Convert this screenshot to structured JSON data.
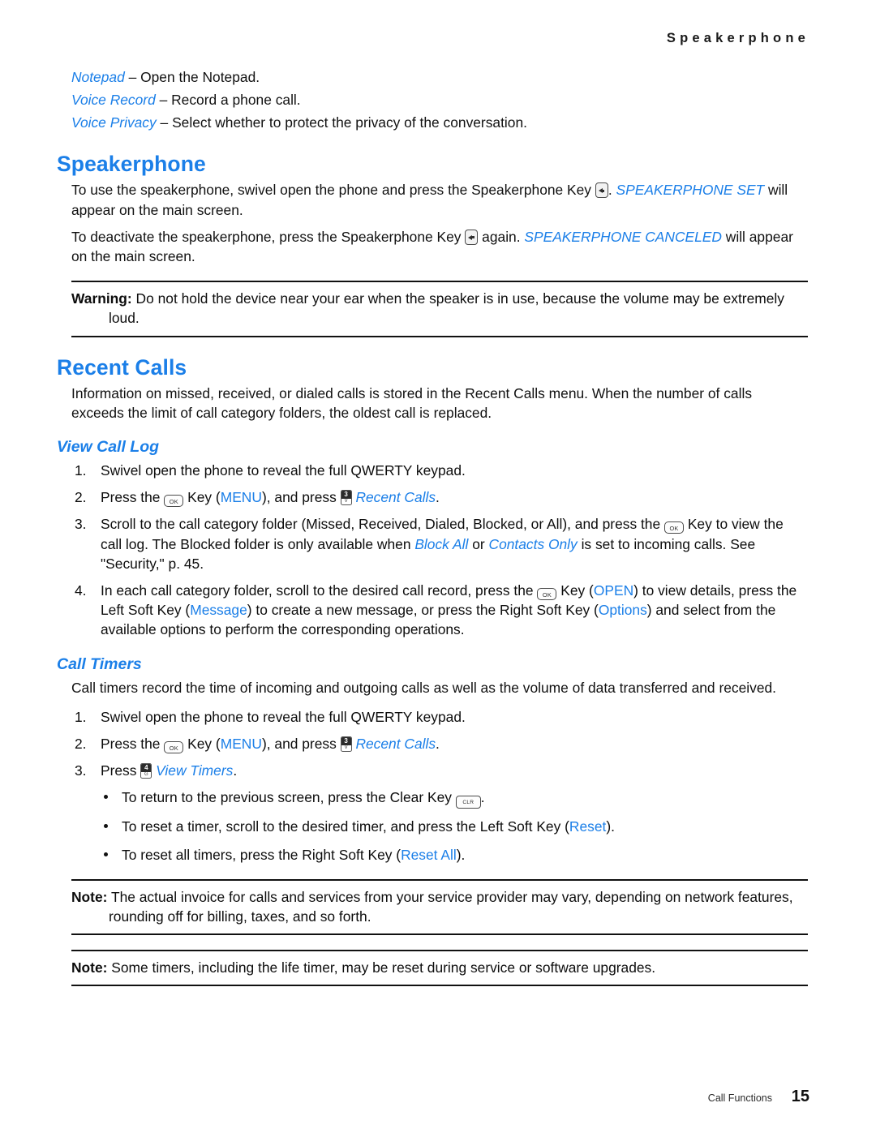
{
  "header": {
    "running_head": "Speakerphone"
  },
  "intro_definitions": [
    {
      "term": "Notepad",
      "dash": "–",
      "description": "Open the Notepad."
    },
    {
      "term": "Voice Record",
      "dash": "–",
      "description": "Record a phone call."
    },
    {
      "term": "Voice Privacy",
      "dash": "–",
      "description": "Select whether to protect the privacy of the conversation."
    }
  ],
  "speakerphone": {
    "heading": "Speakerphone",
    "para1_a": "To use the speakerphone, swivel open the phone and press the Speakerphone Key ",
    "para1_b": ". ",
    "para1_emph": "SPEAKERPHONE SET",
    "para1_c": " will appear on the main screen.",
    "para2_a": "To deactivate the speakerphone, press the Speakerphone Key ",
    "para2_b": " again. ",
    "para2_emph": "SPEAKERPHONE CANCELED",
    "para2_c": " will appear on the main screen.",
    "warning_label": "Warning:",
    "warning_text": " Do not hold the device near your ear when the speaker is in use, because the volume may be extremely loud."
  },
  "recent_calls": {
    "heading": "Recent Calls",
    "intro": "Information on missed, received, or dialed calls is stored in the Recent Calls menu. When the number of calls exceeds the limit of call category folders, the oldest call is replaced.",
    "view_call_log": {
      "heading": "View Call Log",
      "step1": {
        "num": "1.",
        "text": "Swivel open the phone to reveal the full QWERTY keypad."
      },
      "step2": {
        "num": "2.",
        "a": "Press the ",
        "b": " Key (",
        "menu": "MENU",
        "c": "), and press ",
        "link": "Recent Calls",
        "d": "."
      },
      "step3": {
        "num": "3.",
        "a": "Scroll to the call category folder (Missed, Received, Dialed, Blocked, or All), and press the ",
        "b": " Key to view the call log. The Blocked folder is only available when ",
        "block_all": "Block All",
        "c": " or ",
        "contacts_only": "Contacts Only",
        "d": " is set to incoming calls. See \"Security,\" p. 45."
      },
      "step4": {
        "num": "4.",
        "a": "In each call category folder, scroll to the desired call record, press the ",
        "b": " Key (",
        "open": "OPEN",
        "c": ") to view details, press the Left Soft Key (",
        "message": "Message",
        "d": ") to create a new message, or press the Right Soft Key (",
        "options": "Options",
        "e": ") and select from the available options to perform the corresponding operations."
      }
    },
    "call_timers": {
      "heading": "Call Timers",
      "intro": "Call timers record the time of incoming and outgoing calls as well as the volume of data transferred and received.",
      "step1": {
        "num": "1.",
        "text": "Swivel open the phone to reveal the full QWERTY keypad."
      },
      "step2": {
        "num": "2.",
        "a": "Press the ",
        "b": " Key (",
        "menu": "MENU",
        "c": "), and press ",
        "link": "Recent Calls",
        "d": "."
      },
      "step3": {
        "num": "3.",
        "a": "Press ",
        "link": "View Timers",
        "b": "."
      },
      "bullets": [
        {
          "a": "To return to the previous screen, press the Clear Key ",
          "b": ".",
          "c": "",
          "emph": ""
        },
        {
          "a": "To reset a timer, scroll to the desired timer, and press the Left Soft Key (",
          "emph": "Reset",
          "b": ").",
          "c": ""
        },
        {
          "a": "To reset all timers, press the Right Soft Key (",
          "emph": "Reset All",
          "b": ").",
          "c": ""
        }
      ]
    },
    "note1": {
      "label": "Note:",
      "text": " The actual invoice for calls and services from your service provider may vary, depending on network features, rounding off for billing, taxes, and so forth."
    },
    "note2": {
      "label": "Note:",
      "text": " Some timers, including the life timer, may be reset during service or software upgrades."
    }
  },
  "keys": {
    "ok": "OK",
    "clr": "CLR",
    "speakerphone_icon": "speakerphone-key-icon",
    "recent_calls_key_digit": "3",
    "recent_calls_key_letter": "V",
    "view_timers_key_digit": "4",
    "view_timers_key_letter": "G"
  },
  "footer": {
    "chapter": "Call Functions",
    "page_number": "15"
  },
  "colors": {
    "accent_blue": "#1b7fe8",
    "body_text": "#111111",
    "rule": "#111111"
  }
}
